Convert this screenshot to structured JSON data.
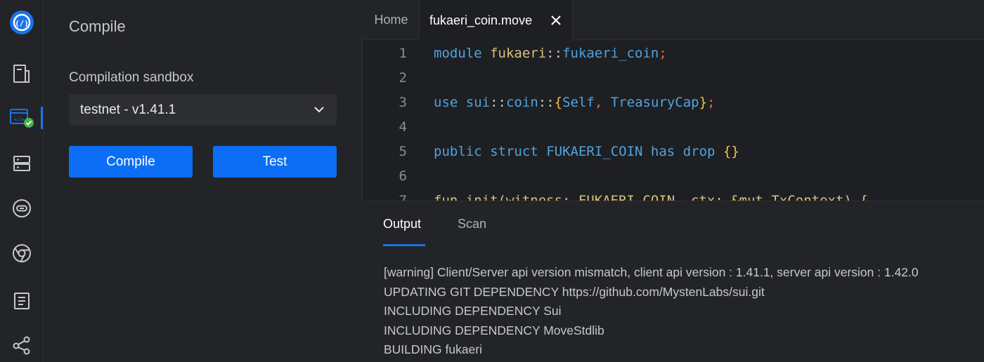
{
  "sidebar": {
    "title": "Compile",
    "sandbox_label": "Compilation sandbox",
    "sandbox_selected": "testnet - v1.41.1",
    "compile_label": "Compile",
    "test_label": "Test"
  },
  "activity_icons": [
    "logo-icon",
    "file-icon",
    "code-compile-icon",
    "server-icon",
    "link-icon",
    "chrome-icon",
    "document-icon",
    "share-icon"
  ],
  "tabs": {
    "home": "Home",
    "file": "fukaeri_coin.move"
  },
  "code": {
    "line_numbers": [
      "1",
      "2",
      "3",
      "4",
      "5",
      "6",
      "7"
    ],
    "line1": {
      "kw": "module",
      "pkg": "fukaeri",
      "sep": "::",
      "mod": "fukaeri_coin",
      "end": ";"
    },
    "line3": {
      "kw": "use",
      "pkg": "sui",
      "sep1": "::",
      "mod": "coin",
      "sep2": "::",
      "ob": "{",
      "a": "Self",
      "comma": ",",
      "b": "TreasuryCap",
      "cb": "}",
      "end": ";"
    },
    "line5": {
      "kw1": "public",
      "kw2": "struct",
      "name": "FUKAERI_COIN",
      "kw3": "has",
      "kw4": "drop",
      "braces": "{}"
    },
    "line7": {
      "text": "fun init(witness: FUKAERI_COIN, ctx: &mut TxContext) {"
    }
  },
  "panel": {
    "tab_output": "Output",
    "tab_scan": "Scan",
    "lines": [
      "[warning] Client/Server api version mismatch, client api version : 1.41.1, server api version : 1.42.0",
      "UPDATING GIT DEPENDENCY https://github.com/MystenLabs/sui.git",
      "INCLUDING DEPENDENCY Sui",
      "INCLUDING DEPENDENCY MoveStdlib",
      "BUILDING fukaeri"
    ]
  },
  "colors": {
    "accent": "#1a73e8",
    "button": "#0b6ef5",
    "success": "#4caf50"
  }
}
